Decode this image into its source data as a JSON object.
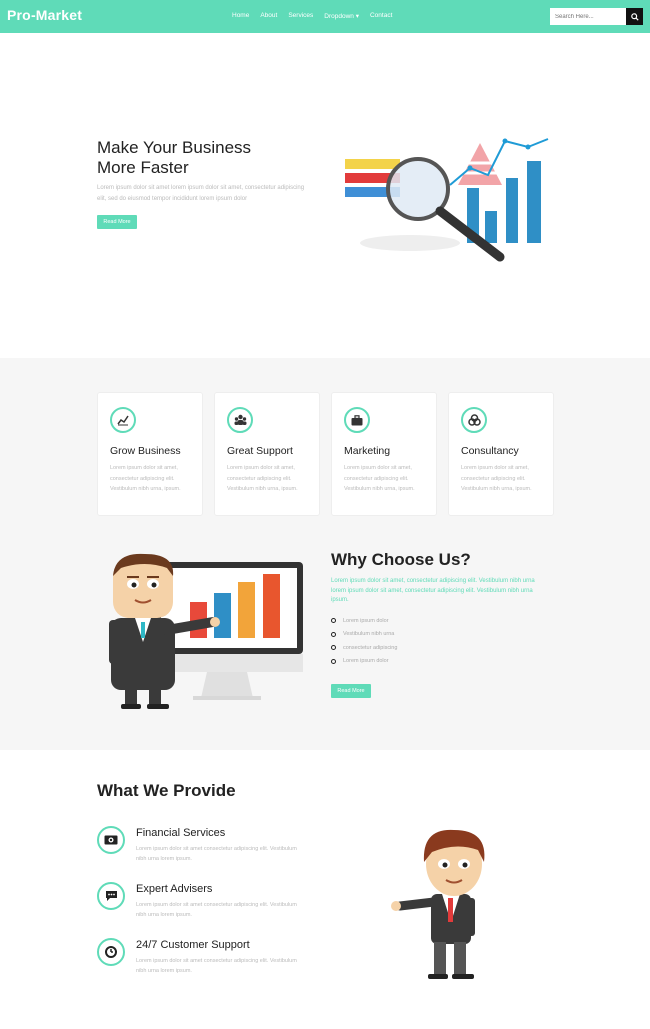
{
  "brand": "Pro-Market",
  "nav": [
    "Home",
    "About",
    "Services",
    "Dropdown ▾",
    "Contact"
  ],
  "search": {
    "placeholder": "Search Here..."
  },
  "hero": {
    "title_line1": "Make Your Business",
    "title_line2": "More Faster",
    "text": "Lorem ipsum dolor sit amet lorem ipsum dolor sit amet, consectetur adipiscing elit, sed do eiusmod tempor incididunt lorem ipsum dolor",
    "button": "Read More"
  },
  "services": [
    {
      "icon": "chart-line-icon",
      "title": "Grow Business",
      "text": "Lorem ipsum dolor sit amet, consectetur adipiscing elit. Vestibulum nibh urna, ipsum."
    },
    {
      "icon": "users-icon",
      "title": "Great Support",
      "text": "Lorem ipsum dolor sit amet, consectetur adipiscing elit. Vestibulum nibh urna, ipsum."
    },
    {
      "icon": "briefcase-icon",
      "title": "Marketing",
      "text": "Lorem ipsum dolor sit amet, consectetur adipiscing elit. Vestibulum nibh urna, ipsum."
    },
    {
      "icon": "cubes-icon",
      "title": "Consultancy",
      "text": "Lorem ipsum dolor sit amet, consectetur adipiscing elit. Vestibulum nibh urna, ipsum."
    }
  ],
  "why": {
    "title": "Why Choose Us?",
    "text": "Lorem ipsum dolor sit amet, consectetur adipiscing elit. Vestibulum nibh urna lorem ipsum dolor sit amet, consectetur adipiscing elit. Vestibulum nibh urna ipsum.",
    "list": [
      "Lorem ipsum dolor",
      "Vestibulum nibh urna",
      "consectetur adipiscing",
      "Lorem ipsum dolor"
    ],
    "button": "Read More"
  },
  "provide": {
    "title": "What We Provide",
    "items": [
      {
        "icon": "money-icon",
        "title": "Financial Services",
        "text": "Lorem ipsum dolor sit amet consectetur adipiscing elit. Vestibulum nibh urna lorem ipsum."
      },
      {
        "icon": "chat-icon",
        "title": "Expert Advisers",
        "text": "Lorem ipsum dolor sit amet consectetur adipiscing elit. Vestibulum nibh urna lorem ipsum."
      },
      {
        "icon": "clock-icon",
        "title": "24/7 Customer Support",
        "text": "Lorem ipsum dolor sit amet consectetur adipiscing elit. Vestibulum nibh urna lorem ipsum."
      }
    ]
  },
  "colors": {
    "accent": "#5fdbb8",
    "dark": "#222222",
    "muted": "#bbbbbb",
    "section_bg": "#f6f6f6"
  }
}
